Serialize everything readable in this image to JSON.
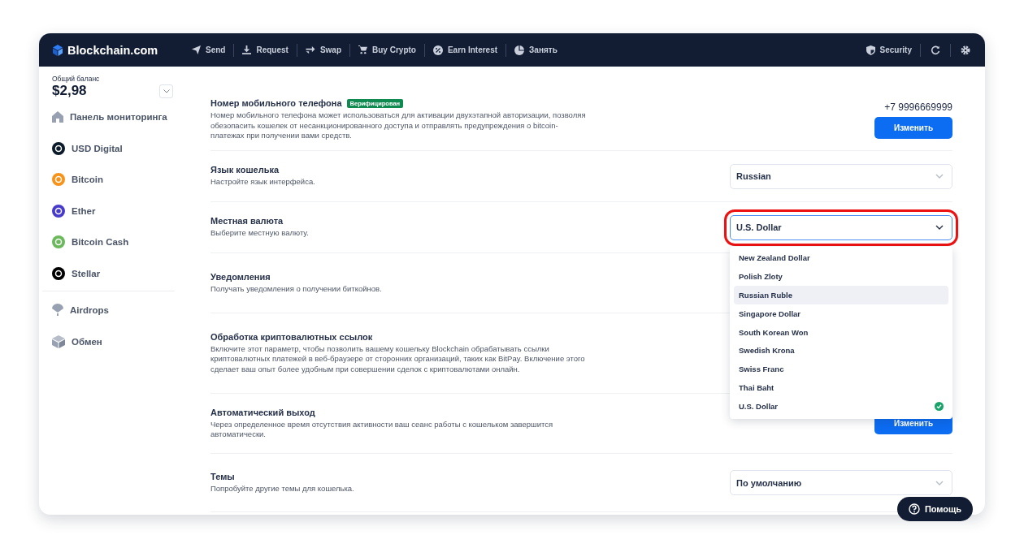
{
  "brand": "Blockchain.com",
  "nav": [
    {
      "label": "Send"
    },
    {
      "label": "Request"
    },
    {
      "label": "Swap"
    },
    {
      "label": "Buy Crypto"
    },
    {
      "label": "Earn Interest"
    },
    {
      "label": "Занять"
    }
  ],
  "nav_right": {
    "security": "Security"
  },
  "balance": {
    "label": "Общий баланс",
    "amount": "$2,98"
  },
  "sidebar": {
    "items": [
      {
        "label": "Панель мониторинга",
        "kind": "home"
      },
      {
        "label": "USD Digital",
        "kind": "coin",
        "color": "#0c1b2a"
      },
      {
        "label": "Bitcoin",
        "kind": "coin",
        "color": "#f7931a"
      },
      {
        "label": "Ether",
        "kind": "coin",
        "color": "#473bcb"
      },
      {
        "label": "Bitcoin Cash",
        "kind": "coin",
        "color": "#6cb85d"
      },
      {
        "label": "Stellar",
        "kind": "coin",
        "color": "#000000"
      }
    ],
    "extra_items": [
      {
        "label": "Airdrops",
        "kind": "parachute"
      },
      {
        "label": "Обмен",
        "kind": "exchange"
      }
    ]
  },
  "settings": [
    {
      "title": "Номер мобильного телефона",
      "badge": "Верифицирован",
      "description": "Номер мобильного телефона может использоваться для активации двухэтапной авторизации, позволяя обезопасить кошелек от несанкционированного доступа и отправлять предупреждения о bitcoin-платежах при получении вами средств.",
      "control": {
        "kind": "button",
        "value": "+7 9996669999",
        "label": "Изменить"
      }
    },
    {
      "title": "Язык кошелька",
      "description": "Настройте язык интерфейса.",
      "control": {
        "kind": "select",
        "value": "Russian",
        "highlighted": false,
        "expanded": false
      }
    },
    {
      "title": "Местная валюта",
      "description": "Выберите местную валюту.",
      "control": {
        "kind": "select",
        "value": "U.S. Dollar",
        "highlighted": true,
        "expanded": true,
        "options": [
          {
            "label": "New Zealand Dollar",
            "selected": false,
            "hovered": false
          },
          {
            "label": "Polish Zloty",
            "selected": false,
            "hovered": false
          },
          {
            "label": "Russian Ruble",
            "selected": false,
            "hovered": true
          },
          {
            "label": "Singapore Dollar",
            "selected": false,
            "hovered": false
          },
          {
            "label": "South Korean Won",
            "selected": false,
            "hovered": false
          },
          {
            "label": "Swedish Krona",
            "selected": false,
            "hovered": false
          },
          {
            "label": "Swiss Franc",
            "selected": false,
            "hovered": false
          },
          {
            "label": "Thai Baht",
            "selected": false,
            "hovered": false
          },
          {
            "label": "U.S. Dollar",
            "selected": true,
            "hovered": false
          }
        ]
      }
    },
    {
      "title": "Уведомления",
      "description": "Получать уведомления о получении биткойнов."
    },
    {
      "title": "Обработка криптовалютных ссылок",
      "description": "Включите этот параметр, чтобы позволить вашему кошельку Blockchain обрабатывать ссылки криптовалютных платежей в веб-браузере от сторонних организаций, таких как BitPay. Включение этого сделает ваш опыт более удобным при совершении сделок с криптовалютами онлайн."
    },
    {
      "title": "Автоматический выход",
      "description": "Через определенное время отсутствия активности ваш сеанс работы с кошельком завершится автоматически.",
      "control": {
        "kind": "button",
        "label": "Изменить"
      }
    },
    {
      "title": "Темы",
      "description": "Попробуйте другие темы для кошелька.",
      "control": {
        "kind": "select",
        "value": "По умолчанию",
        "highlighted": false,
        "expanded": false
      }
    }
  ],
  "help": {
    "label": "Помощь"
  }
}
